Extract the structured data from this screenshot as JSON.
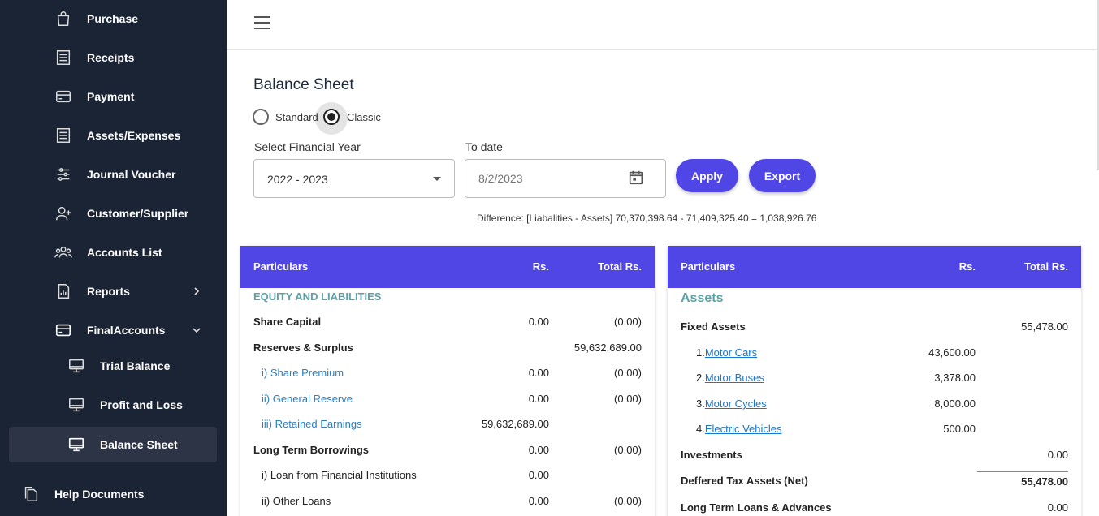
{
  "sidebar": {
    "items": [
      {
        "label": "Purchase",
        "icon": "shopping-bag-icon"
      },
      {
        "label": "Receipts",
        "icon": "receipt-icon"
      },
      {
        "label": "Payment",
        "icon": "credit-card-icon"
      },
      {
        "label": "Assets/Expenses",
        "icon": "list-icon"
      },
      {
        "label": "Journal Voucher",
        "icon": "sliders-icon"
      },
      {
        "label": "Customer/Supplier",
        "icon": "user-plus-icon"
      },
      {
        "label": "Accounts List",
        "icon": "users-icon"
      },
      {
        "label": "Reports",
        "icon": "report-icon"
      },
      {
        "label": "FinalAccounts",
        "icon": "card-icon"
      },
      {
        "label": "Trial Balance",
        "icon": "monitor-icon"
      },
      {
        "label": "Profit and Loss",
        "icon": "monitor-icon"
      },
      {
        "label": "Balance Sheet",
        "icon": "monitor-icon"
      },
      {
        "label": "Help Documents",
        "icon": "copy-icon"
      }
    ]
  },
  "page": {
    "title": "Balance Sheet",
    "radio_standard": "Standard",
    "radio_classic": "Classic",
    "fy_label": "Select Financial Year",
    "fy_value": "2022 - 2023",
    "todate_label": "To date",
    "todate_placeholder": "8/2/2023",
    "apply": "Apply",
    "export": "Export",
    "difference": "Difference: [Liabalities - Assets] 70,370,398.64 - 71,409,325.40 = 1,038,926.76"
  },
  "left": {
    "headers": [
      "Particulars",
      "Rs.",
      "Total Rs."
    ],
    "section": "EQUITY AND LIABILITIES",
    "rows": [
      {
        "name": "Share Capital",
        "rs": "0.00",
        "total": "(0.00)"
      },
      {
        "name": "Reserves & Surplus",
        "rs": "",
        "total": "59,632,689.00"
      },
      {
        "name": "i) Share Premium",
        "rs": "0.00",
        "total": "(0.00)"
      },
      {
        "name": "ii) General Reserve",
        "rs": "0.00",
        "total": "(0.00)"
      },
      {
        "name": "iii) Retained Earnings",
        "rs": "59,632,689.00",
        "total": ""
      },
      {
        "name": "Long Term Borrowings",
        "rs": "0.00",
        "total": "(0.00)"
      },
      {
        "name": "i) Loan from Financial Institutions",
        "rs": "0.00",
        "total": ""
      },
      {
        "name": "ii) Other Loans",
        "rs": "0.00",
        "total": "(0.00)"
      }
    ]
  },
  "right": {
    "headers": [
      "Particulars",
      "Rs.",
      "Total Rs."
    ],
    "section": "Assets",
    "rows": [
      {
        "name": "Fixed Assets",
        "rs": "",
        "total": "55,478.00"
      },
      {
        "num": "1.",
        "name": "Motor Cars",
        "rs": "43,600.00",
        "total": ""
      },
      {
        "num": "2.",
        "name": "Motor Buses",
        "rs": "3,378.00",
        "total": ""
      },
      {
        "num": "3.",
        "name": "Motor Cycles",
        "rs": "8,000.00",
        "total": ""
      },
      {
        "num": "4.",
        "name": "Electric Vehicles",
        "rs": "500.00",
        "total": ""
      },
      {
        "name": "Investments",
        "rs": "",
        "total": "0.00"
      },
      {
        "name": "Deffered Tax Assets (Net)",
        "rs": "",
        "total": "55,478.00"
      },
      {
        "name": "Long Term Loans & Advances",
        "rs": "",
        "total": "0.00"
      }
    ]
  }
}
